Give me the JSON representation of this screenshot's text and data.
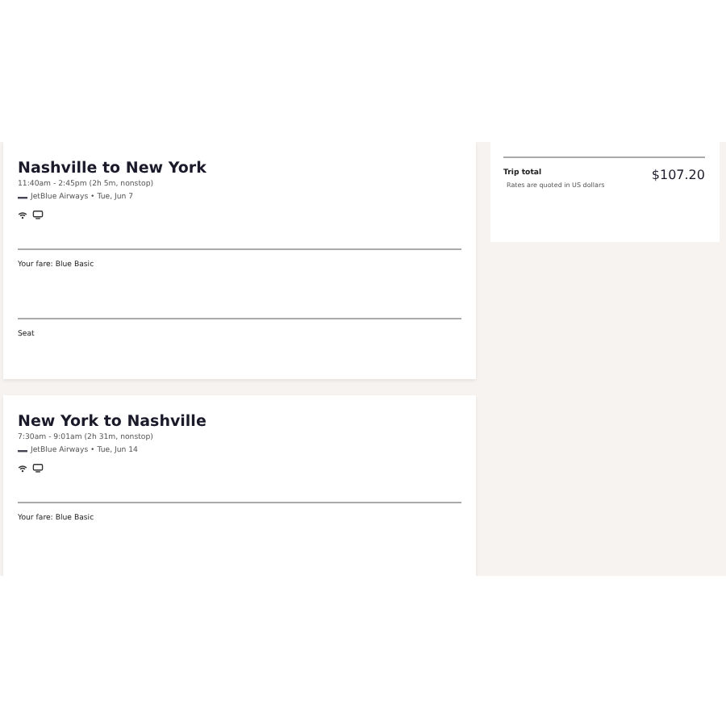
{
  "flights": [
    {
      "title": "Nashville to New York",
      "times": "11:40am - 2:45pm (2h 5m, nonstop)",
      "carrier": "JetBlue Airways • Tue, Jun 7",
      "fare": "Your fare: Blue Basic",
      "seat": "Seat"
    },
    {
      "title": "New York to Nashville",
      "times": "7:30am - 9:01am (2h 31m, nonstop)",
      "carrier": "JetBlue Airways • Tue, Jun 14",
      "fare": "Your fare: Blue Basic"
    }
  ],
  "summary": {
    "label": "Trip total",
    "note": "Rates are quoted in US dollars",
    "amount": "$107.20"
  }
}
